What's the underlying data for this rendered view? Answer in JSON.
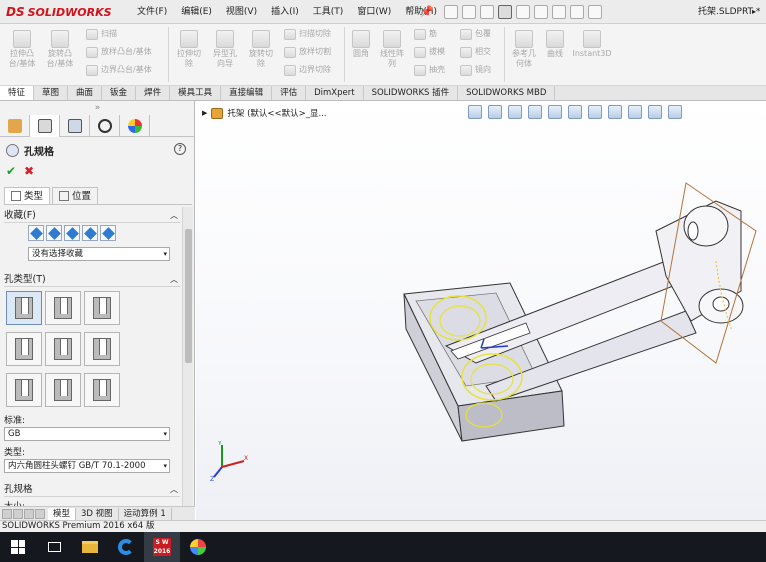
{
  "app": {
    "brand": "SOLIDWORKS",
    "brand_mark": "DS",
    "document_title": "托架.SLDPRT *"
  },
  "menu": [
    "文件(F)",
    "编辑(E)",
    "视图(V)",
    "插入(I)",
    "工具(T)",
    "窗口(W)",
    "帮助(H)"
  ],
  "ribbon": {
    "large_buttons": [
      "拉伸凸\n台/基体",
      "旋转凸\n台/基体",
      "拉伸切\n除",
      "异型孔\n向导",
      "旋转切\n除",
      "圆角",
      "线性阵\n列",
      "参考几\n何体",
      "曲线",
      "Instant3D"
    ],
    "small_buttons": [
      "扫描",
      "放样凸台/基体",
      "边界凸台/基体",
      "扫描切除",
      "放样切割",
      "边界切除",
      "筋",
      "拔模",
      "抽壳",
      "包覆",
      "相交",
      "镜向"
    ]
  },
  "command_tabs": [
    "特征",
    "草图",
    "曲面",
    "钣金",
    "焊件",
    "模具工具",
    "直接编辑",
    "评估",
    "DimXpert",
    "SOLIDWORKS 插件",
    "SOLIDWORKS MBD"
  ],
  "property_manager": {
    "title": "孔规格",
    "help": "?",
    "ok": "✔",
    "cancel": "✖",
    "tabs": [
      "类型",
      "位置"
    ],
    "favorites_label": "收藏(F)",
    "favorites_value": "没有选择收藏",
    "hole_type_label": "孔类型(T)",
    "standard_label": "标准:",
    "standard_value": "GB",
    "type_label": "类型:",
    "type_value": "内六角圆柱头螺钉 GB/T 70.1-2000",
    "spec_label": "孔规格",
    "size_label": "大小:",
    "sash": "»"
  },
  "bottom_tabs": [
    "模型",
    "3D 视图",
    "运动算例 1"
  ],
  "status_bar": "SOLIDWORKS Premium 2016 x64 版",
  "viewport": {
    "breadcrumb": "托架  (默认<<默认>_显...",
    "triad_labels": [
      "Y",
      "X",
      "Z"
    ]
  },
  "taskbar": {
    "sw_label": "S W\n2016"
  }
}
